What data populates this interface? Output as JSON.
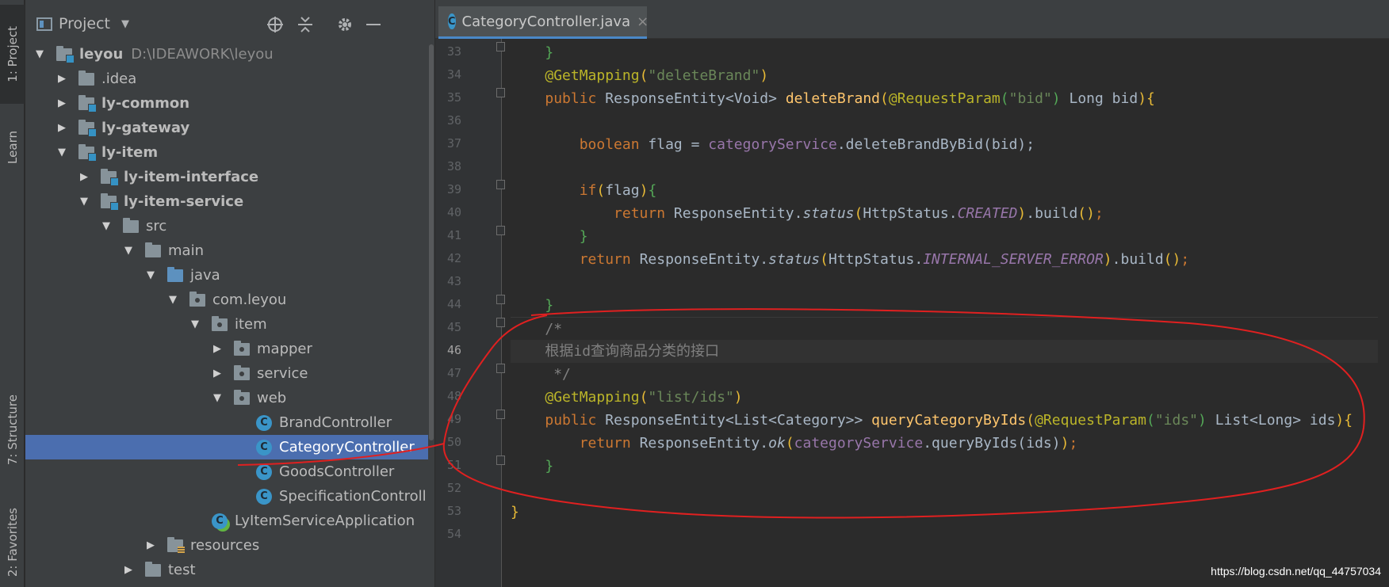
{
  "stripe": {
    "project": "1: Project",
    "learn": "Learn",
    "structure": "7: Structure",
    "favorites": "2: Favorites"
  },
  "project_panel": {
    "title": "Project",
    "icons": [
      "locate-icon",
      "collapse-all-icon",
      "gear-icon",
      "minimize-icon"
    ]
  },
  "tree": [
    {
      "label": "leyou",
      "path": "D:\\IDEAWORK\\leyou",
      "bold": true
    },
    {
      "label": ".idea"
    },
    {
      "label": "ly-common",
      "bold": true
    },
    {
      "label": "ly-gateway",
      "bold": true
    },
    {
      "label": "ly-item",
      "bold": true
    },
    {
      "label": "ly-item-interface",
      "bold": true
    },
    {
      "label": "ly-item-service",
      "bold": true
    },
    {
      "label": "src"
    },
    {
      "label": "main"
    },
    {
      "label": "java"
    },
    {
      "label": "com.leyou"
    },
    {
      "label": "item"
    },
    {
      "label": "mapper"
    },
    {
      "label": "service"
    },
    {
      "label": "web"
    },
    {
      "label": "BrandController"
    },
    {
      "label": "CategoryController",
      "selected": true
    },
    {
      "label": "GoodsController"
    },
    {
      "label": "SpecificationControll"
    },
    {
      "label": "LyItemServiceApplication"
    },
    {
      "label": "resources"
    },
    {
      "label": "test"
    }
  ],
  "editor": {
    "tab_label": "CategoryController.java",
    "tab_close": "×",
    "line_numbers": [
      "33",
      "34",
      "35",
      "36",
      "37",
      "38",
      "39",
      "40",
      "41",
      "42",
      "43",
      "44",
      "45",
      "46",
      "47",
      "48",
      "49",
      "50",
      "51",
      "52",
      "53",
      "54"
    ],
    "current_line": "46",
    "lines": [
      {
        "l1": "}"
      },
      {
        "l2": "@GetMapping(",
        "l2b": "\"deleteBrand\"",
        "l2c": ")"
      },
      {
        "text": "public ResponseEntity<Void> deleteBrand(@RequestParam(\"bid\") Long bid){"
      },
      {
        "text": ""
      },
      {
        "text": "boolean flag = categoryService.deleteBrandByBid(bid);"
      },
      {
        "text": ""
      },
      {
        "text": "if(flag){"
      },
      {
        "text": "return ResponseEntity.status(HttpStatus.CREATED).build();"
      },
      {
        "text": "}"
      },
      {
        "text": "return ResponseEntity.status(HttpStatus.INTERNAL_SERVER_ERROR).build();"
      },
      {
        "text": ""
      },
      {
        "text": "}"
      },
      {
        "text": "/*"
      },
      {
        "text": "根据id查询商品分类的接口"
      },
      {
        "text": " */"
      },
      {
        "text": "@GetMapping(\"list/ids\")"
      },
      {
        "text": "public ResponseEntity<List<Category>> queryCategoryByIds(@RequestParam(\"ids\") List<Long> ids){"
      },
      {
        "text": "return ResponseEntity.ok(categoryService.queryByIds(ids));"
      },
      {
        "text": "}"
      },
      {
        "text": ""
      },
      {
        "text": "}"
      },
      {
        "text": ""
      }
    ]
  },
  "code_tokens": {
    "brace_close": "}",
    "brace_open": "{",
    "getmapping": "@GetMapping",
    "requestparam": "@RequestParam",
    "lparen": "(",
    "rparen": ")",
    "s_deleteBrand": "\"deleteBrand\"",
    "s_bid": "\"bid\"",
    "s_listids": "\"list/ids\"",
    "s_ids": "\"ids\"",
    "kw_public": "public",
    "kw_boolean": "boolean",
    "kw_if": "if",
    "kw_return": "return",
    "t_responseentity_void": " ResponseEntity<Void> ",
    "fn_deleteBrand": "deleteBrand",
    "t_long_bid": " Long bid",
    "t_flag_eq": " flag = ",
    "f_categoryService": "categoryService",
    "t_deleteBrandByBid": ".deleteBrandByBid(bid);",
    "t_flag": "flag",
    "t_re_dot": " ResponseEntity.",
    "m_status": "status",
    "t_httpstatus": "HttpStatus.",
    "c_created": "CREATED",
    "c_ise": "INTERNAL_SERVER_ERROR",
    "t_build": ".build",
    "t_semicolon": ";",
    "cm_open": "/*",
    "cm_body": "根据id查询商品分类的接口",
    "cm_close": " */",
    "t_re_list_cat": " ResponseEntity<List<Category>> ",
    "fn_queryCategoryByIds": "queryCategoryByIds",
    "t_list_long_ids": " List<Long> ids",
    "m_ok": "ok",
    "t_queryByIds": ".queryByIds(ids)",
    "t_paren_empty": "()"
  },
  "watermark": "https://blog.csdn.net/qq_44757034",
  "colors": {
    "annotation_stroke": "#e02020",
    "selection": "#4b6eaf",
    "keyword": "#cc7832",
    "string": "#6a8759",
    "annotation": "#bbb529",
    "method": "#ffc66d",
    "field": "#9876aa",
    "comment": "#808080"
  }
}
